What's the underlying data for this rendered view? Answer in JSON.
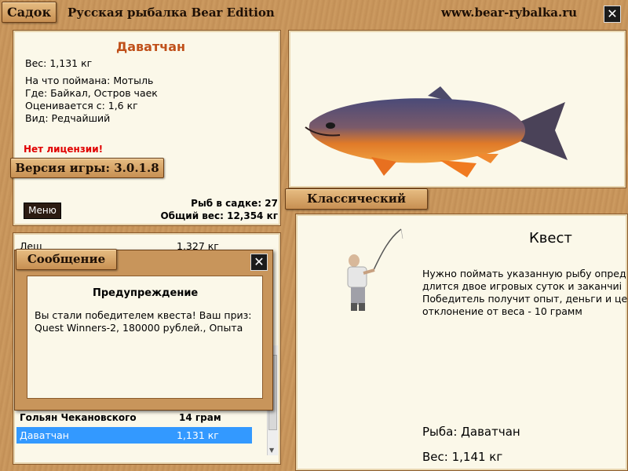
{
  "header": {
    "tab_label": "Садок",
    "title": "Русская рыбалка Bear Edition",
    "site": "www.bear-rybalka.ru",
    "close": "✕"
  },
  "fish_info": {
    "name": "Даватчан",
    "weight": "Вес: 1,131 кг",
    "bait": "На что поймана: Мотыль",
    "location": "Где: Байкал, Остров чаек",
    "valued_from": "Оценивается с: 1,6 кг",
    "rarity": "Вид: Редчайший",
    "no_license": "Нет лицензии!",
    "version": "Версия игры: 3.0.1.8",
    "menu_button": "Меню",
    "fish_count": "Рыб в садке: 27",
    "total_weight": "Общий вес: 12,354 кг"
  },
  "catch_list": {
    "rows": [
      {
        "name": "Лещ",
        "weight": "1,327 кг"
      },
      {
        "name": "Гольян Чекановского",
        "weight": "14 грам"
      }
    ],
    "selected": {
      "name": "Даватчан",
      "weight": "1,131 кг"
    }
  },
  "message": {
    "tab_label": "Сообщение",
    "close": "✕",
    "heading": "Предупреждение",
    "line1": "Вы стали победителем квеста! Ваш приз:",
    "line2": "Quest Winners-2, 180000 рублей., Опыта"
  },
  "quest": {
    "tab_label": "Классический квест",
    "title": "Квест",
    "line1": "Нужно поймать указанную рыбу опред",
    "line2": "длится двое игровых суток и заканчиi",
    "line3": "Победитель получит опыт, деньги и це",
    "line4": "отклонение от веса - 10 грамм",
    "fish": "Рыба: Даватчан",
    "weight": "Вес: 1,141 кг"
  },
  "icons": {
    "close": "close-icon",
    "scroll_up": "chevron-up-icon",
    "scroll_down": "chevron-down-icon",
    "fish": "char-fish-image",
    "angler": "angler-image"
  },
  "colors": {
    "fish_name": "#c0501a",
    "no_license": "#e00000",
    "selection": "#3399ff",
    "panel_bg": "#fbf8e9"
  }
}
